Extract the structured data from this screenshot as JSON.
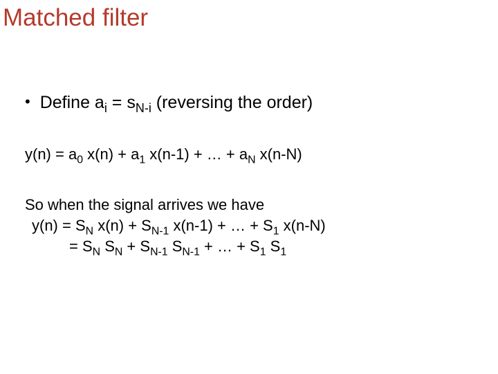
{
  "title": "Matched filter",
  "bullet": {
    "dot": "•",
    "pre": "Define a",
    "sub1": "i",
    "mid": " = s",
    "sub2": "N-i",
    "post": "  (reversing the order)"
  },
  "eq1": {
    "a": "y(n) = a",
    "s0": "0",
    "b": " x(n)  + a",
    "s1": "1",
    "c": " x(n-1) +  … + a",
    "sN": "N",
    "d": " x(n-N)"
  },
  "para": {
    "l1": "So when the signal arrives we have",
    "l2": {
      "a": " y(n) = S",
      "sN": "N",
      "b": " x(n)  + S",
      "sN1": "N-1",
      "c": " x(n-1) + … + S",
      "s1": "1",
      "d": " x(n-N)"
    },
    "l3": {
      "a": "=  S",
      "sNa": "N",
      "b": " S",
      "sNb": "N",
      "c": "   + S",
      "sN1a": "N-1",
      "d": " S",
      "sN1b": "N-1",
      "e": " + … + S",
      "s1a": "1",
      "f": " S",
      "s1b": "1"
    }
  }
}
